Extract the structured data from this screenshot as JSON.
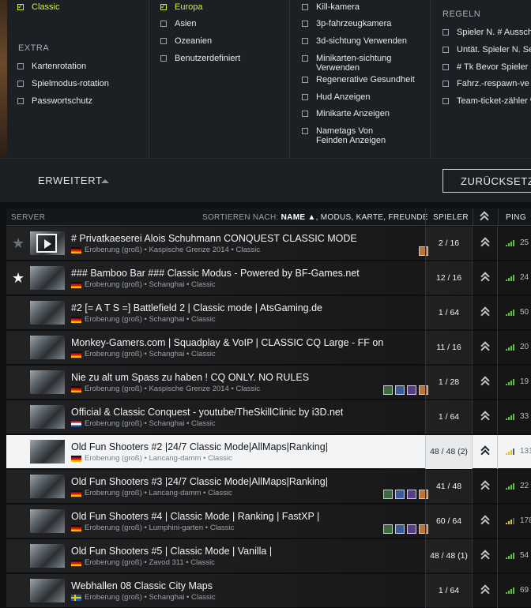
{
  "filters": {
    "col1": {
      "top_item": "Classic",
      "extra_heading": "EXTRA",
      "items": [
        "Kartenrotation",
        "Spielmodus-rotation",
        "Passwortschutz"
      ]
    },
    "col2": {
      "items": [
        "Europa",
        "Asien",
        "Ozeanien",
        "Benutzerdefiniert"
      ]
    },
    "col3": {
      "items": [
        "Kill-kamera",
        "3p-fahrzeugkamera",
        "3d-sichtung Verwenden",
        "Minikarten-sichtung Verwenden",
        "Regenerative Gesundheit",
        "Hud Anzeigen",
        "Minikarte Anzeigen",
        "Nametags Von Feinden Anzeigen"
      ]
    },
    "col4": {
      "heading": "REGELN",
      "items": [
        "Spieler N. # Aussch",
        "Untät. Spieler N. Sek",
        "# Tk Bevor Spieler R",
        "Fahrz.-respawn-ve",
        "Team-ticket-zähler %"
      ]
    }
  },
  "advanced": {
    "label": "ERWEITERT",
    "reset_label": "ZURÜCKSETZ"
  },
  "table_header": {
    "server": "SERVER",
    "sort_prefix": "SORTIEREN NACH:",
    "sort_name": "NAME ▲",
    "sort_rest": ", MODUS, KARTE, FREUNDE",
    "players": "SPIELER",
    "rank": "⌃",
    "ping": "PING"
  },
  "servers": [
    {
      "title": "# Privatkaeserei Alois Schuhmann CONQUEST CLASSIC MODE",
      "meta": "Eroberung (groß) • Kaspische Grenze 2014 • Classic",
      "players": "2 / 16",
      "ping": "25",
      "star": "★"
    },
    {
      "title": "### Bamboo Bar ### Classic Modus - Powered by BF-Games.net",
      "meta": "Eroberung (groß) • Schanghai • Classic",
      "players": "12 / 16",
      "ping": "24",
      "star": "★"
    },
    {
      "title": "#2 [= A T S =] Battlefield 2 | Classic mode | AtsGaming.de",
      "meta": "Eroberung (groß) • Schanghai • Classic",
      "players": "1 / 64",
      "ping": "50"
    },
    {
      "title": "Monkey-Gamers.com | Squadplay & VoIP | CLASSIC CQ Large - FF on",
      "meta": "Eroberung (groß) • Schanghai • Classic",
      "players": "11 / 16",
      "ping": "20"
    },
    {
      "title": "Nie zu alt um Spass zu haben ! CQ ONLY. NO RULES",
      "meta": "Eroberung (groß) • Kaspische Grenze 2014 • Classic",
      "players": "1 / 28",
      "ping": "19"
    },
    {
      "title": "Official & Classic Conquest - youtube/TheSkillClinic by i3D.net",
      "meta": "Eroberung (groß) • Schanghai • Classic",
      "players": "1 / 64",
      "ping": "33"
    },
    {
      "title": "Old Fun Shooters #2 |24/7 Classic Mode|AllMaps|Ranking|",
      "meta": "Eroberung (groß) • Lancang-damm • Classic",
      "players": "48 / 48 (2)",
      "ping": "131"
    },
    {
      "title": "Old Fun Shooters #3 |24/7 Classic Mode|AllMaps|Ranking|",
      "meta": "Eroberung (groß) • Lancang-damm • Classic",
      "players": "41 / 48",
      "ping": "22"
    },
    {
      "title": "Old Fun Shooters #4 | Classic Mode | Ranking | FastXP |",
      "meta": "Eroberung (groß) • Lumphini-garten • Classic",
      "players": "60 / 64",
      "ping": "178"
    },
    {
      "title": "Old Fun Shooters #5 | Classic Mode | Vanilla |",
      "meta": "Eroberung (groß) • Zavod 311 • Classic",
      "players": "48 / 48 (1)",
      "ping": "54"
    },
    {
      "title": "Webhallen 08 Classic City Maps",
      "meta": "Eroberung (groß) • Schanghai • Classic",
      "players": "1 / 64",
      "ping": "69"
    }
  ]
}
